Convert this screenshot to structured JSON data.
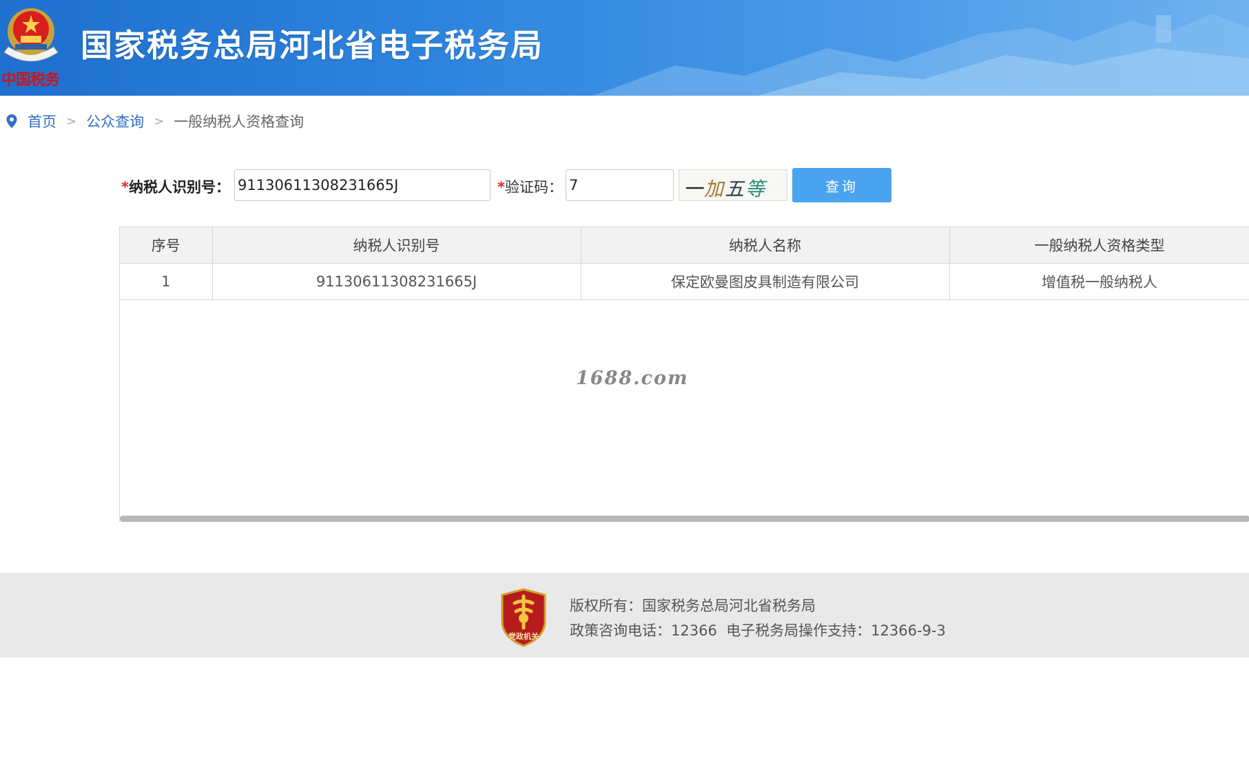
{
  "header": {
    "title": "国家税务总局河北省电子税务局",
    "logo_script": "中国税务",
    "colors": {
      "banner_start": "#1f6fce",
      "banner_end": "#6fb2ef",
      "logo_red": "#c8161d"
    }
  },
  "breadcrumb": {
    "icon": "location-pin-icon",
    "items": [
      "首页",
      "公众查询"
    ],
    "current": "一般纳税人资格查询",
    "separator": ">"
  },
  "form": {
    "required_mark": "*",
    "taxpayer_id_label": "纳税人识别号：",
    "taxpayer_id_value": "91130611308231665J",
    "captcha_label": "验证码：",
    "captcha_value": "7",
    "captcha_image_text": "一加五等于?",
    "query_button": "查询",
    "colors": {
      "button": "#4aa3ef",
      "required": "#e0262b"
    }
  },
  "table": {
    "columns": [
      "序号",
      "纳税人识别号",
      "纳税人名称",
      "一般纳税人资格类型"
    ],
    "rows": [
      [
        "1",
        "91130611308231665J",
        "保定欧曼图皮具制造有限公司",
        "增值税一般纳税人"
      ]
    ]
  },
  "watermark": "1688.com",
  "footer": {
    "badge_text": "党政机关",
    "copyright": "版权所有：国家税务总局河北省税务局",
    "contact": "政策咨询电话：12366  电子税务局操作支持：12366-9-3"
  }
}
